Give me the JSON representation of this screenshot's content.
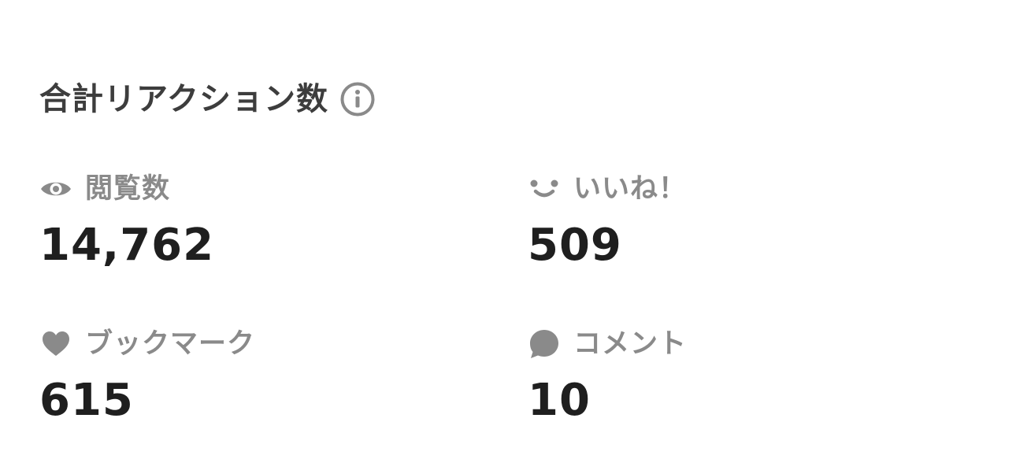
{
  "header": {
    "title": "合計リアクション数",
    "info_icon": "info-icon"
  },
  "stats": [
    {
      "key": "views",
      "label": "閲覧数",
      "value": "14,762",
      "icon": "eye-icon"
    },
    {
      "key": "likes",
      "label": "いいね！",
      "value": "509",
      "icon": "smile-icon"
    },
    {
      "key": "bookmarks",
      "label": "ブックマーク",
      "value": "615",
      "icon": "heart-icon"
    },
    {
      "key": "comments",
      "label": "コメント",
      "value": "10",
      "icon": "speech-bubble-icon"
    }
  ],
  "colors": {
    "title": "#3d3d3d",
    "label": "#8a8a8a",
    "value": "#1f1f1f",
    "icon": "#8a8a8a",
    "background": "#ffffff"
  }
}
